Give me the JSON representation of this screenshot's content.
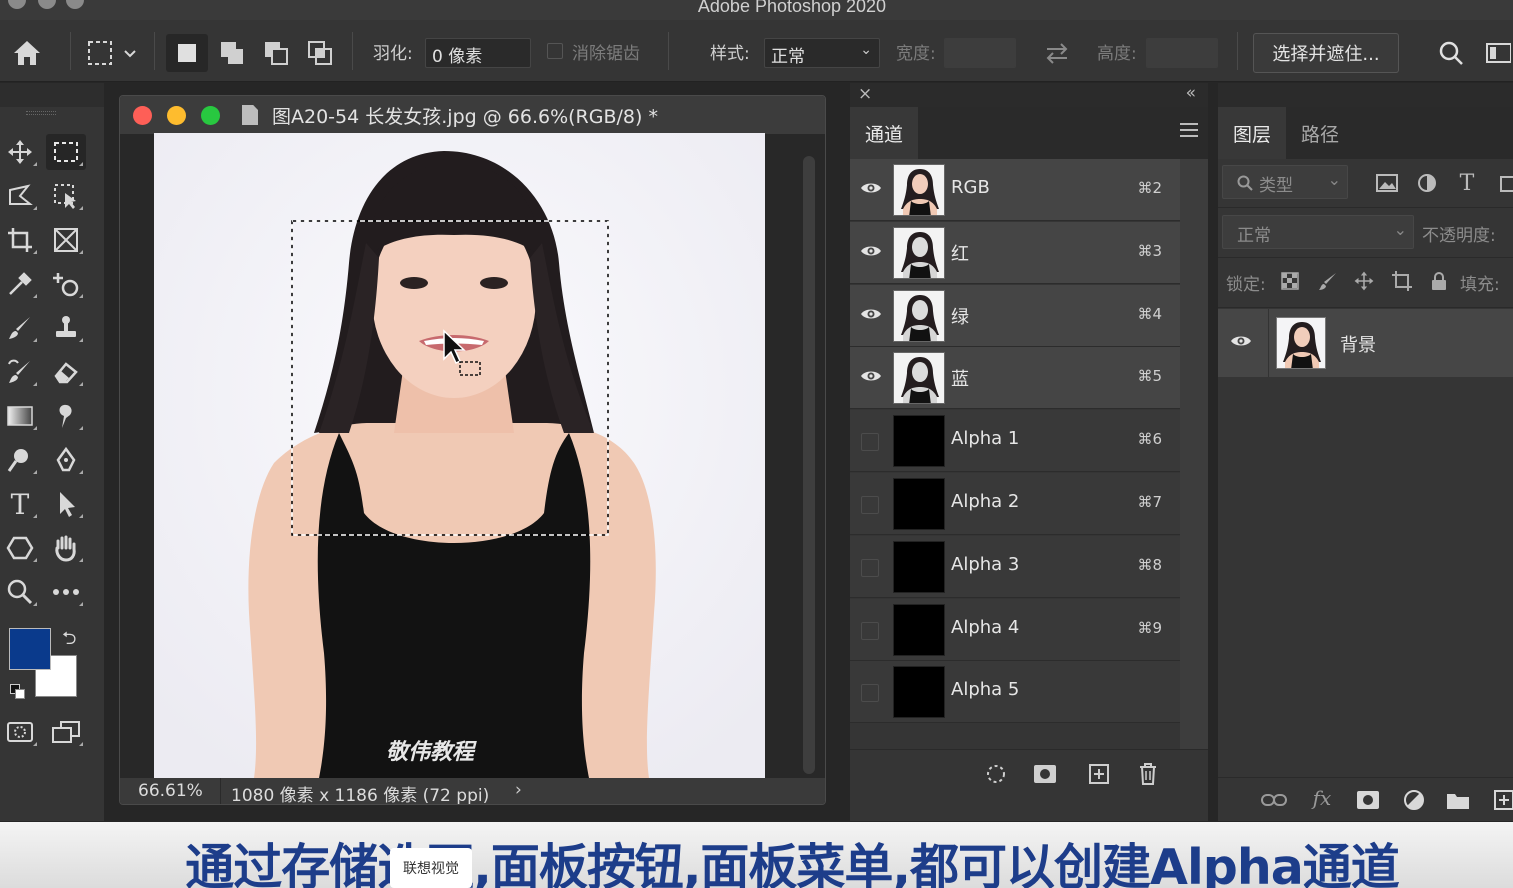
{
  "app": {
    "title": "Adobe Photoshop 2020"
  },
  "options_bar": {
    "feather_label": "羽化:",
    "feather_value": "0 像素",
    "antialias_label": "消除锯齿",
    "style_label": "样式:",
    "style_value": "正常",
    "width_label": "宽度:",
    "height_label": "高度:",
    "select_mask_button": "选择并遮住..."
  },
  "document": {
    "title": "图A20-54 长发女孩.jpg @ 66.6%(RGB/8) *",
    "zoom": "66.61%",
    "size_info": "1080 像素 x 1186 像素 (72 ppi)",
    "canvas_watermark": "敬伟教程"
  },
  "channels_panel": {
    "tab": "通道",
    "channels": [
      {
        "name": "RGB",
        "shortcut": "⌘2",
        "visible": true,
        "type": "image"
      },
      {
        "name": "红",
        "shortcut": "⌘3",
        "visible": true,
        "type": "image"
      },
      {
        "name": "绿",
        "shortcut": "⌘4",
        "visible": true,
        "type": "image"
      },
      {
        "name": "蓝",
        "shortcut": "⌘5",
        "visible": true,
        "type": "image"
      },
      {
        "name": "Alpha 1",
        "shortcut": "⌘6",
        "visible": false,
        "type": "alpha"
      },
      {
        "name": "Alpha 2",
        "shortcut": "⌘7",
        "visible": false,
        "type": "alpha"
      },
      {
        "name": "Alpha 3",
        "shortcut": "⌘8",
        "visible": false,
        "type": "alpha"
      },
      {
        "name": "Alpha 4",
        "shortcut": "⌘9",
        "visible": false,
        "type": "alpha"
      },
      {
        "name": "Alpha 5",
        "shortcut": "",
        "visible": false,
        "type": "alpha"
      }
    ]
  },
  "layers_panel": {
    "tabs": [
      "图层",
      "路径"
    ],
    "filter_placeholder": "类型",
    "blend_mode": "正常",
    "opacity_label": "不透明度:",
    "lock_label": "锁定:",
    "fill_label": "填充:",
    "layers": [
      {
        "name": "背景",
        "visible": true
      }
    ]
  },
  "colors": {
    "foreground": "#0a3a8c",
    "background": "#ffffff",
    "caption_text": "#1d3d8a"
  },
  "caption": {
    "text": "通过存储选区,面板按钮,面板菜单,都可以创建Alpha通道",
    "badge": "联想视觉"
  }
}
